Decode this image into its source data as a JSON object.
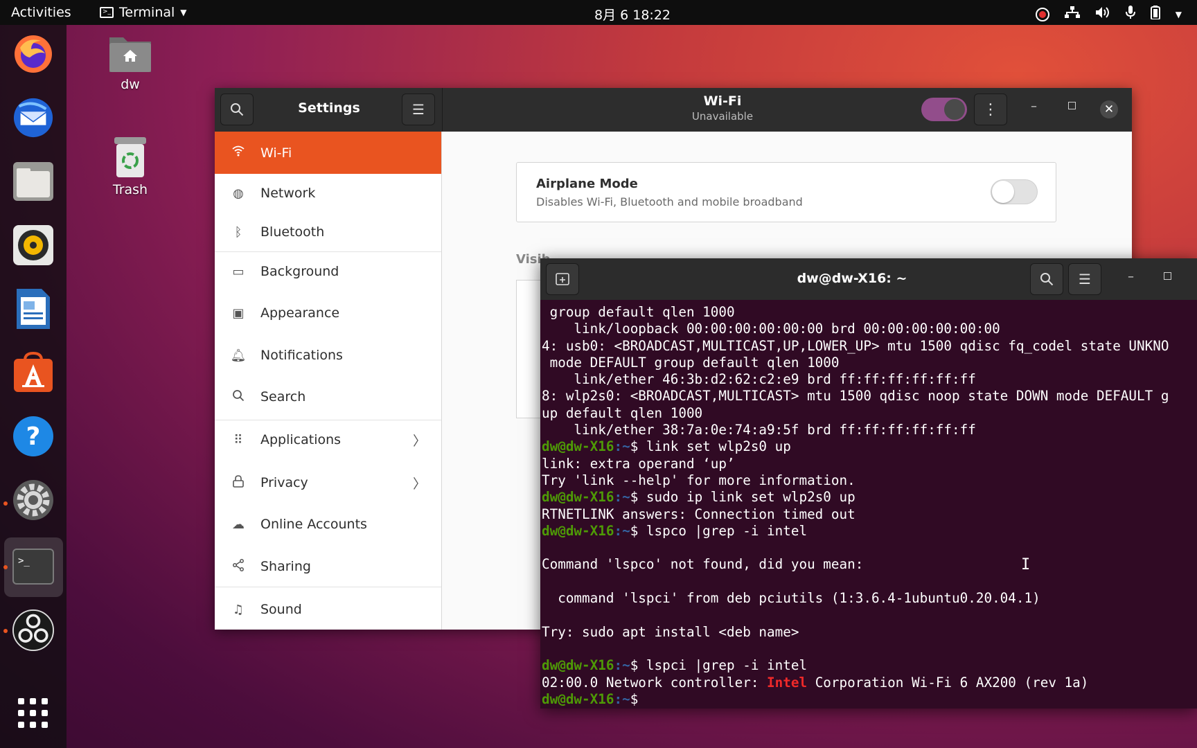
{
  "topbar": {
    "activities": "Activities",
    "app_name": "Terminal",
    "clock": "8月 6  18:22"
  },
  "desktop": {
    "home_label": "dw",
    "trash_label": "Trash"
  },
  "settings": {
    "title": "Settings",
    "panel_title": "Wi-Fi",
    "panel_subtitle": "Unavailable",
    "sidebar": [
      {
        "label": "Wi-Fi",
        "icon": "wifi-icon"
      },
      {
        "label": "Network",
        "icon": "network-icon"
      },
      {
        "label": "Bluetooth",
        "icon": "bluetooth-icon"
      },
      {
        "label": "Background",
        "icon": "background-icon"
      },
      {
        "label": "Appearance",
        "icon": "appearance-icon"
      },
      {
        "label": "Notifications",
        "icon": "bell-icon"
      },
      {
        "label": "Search",
        "icon": "search-icon"
      },
      {
        "label": "Applications",
        "icon": "grid-icon"
      },
      {
        "label": "Privacy",
        "icon": "lock-icon"
      },
      {
        "label": "Online Accounts",
        "icon": "cloud-icon"
      },
      {
        "label": "Sharing",
        "icon": "share-icon"
      },
      {
        "label": "Sound",
        "icon": "music-note-icon"
      }
    ],
    "airplane": {
      "title": "Airplane Mode",
      "desc": "Disables Wi-Fi, Bluetooth and mobile broadband"
    },
    "visible_networks_partial": "Visib"
  },
  "terminal": {
    "title": "dw@dw-X16: ~",
    "prompt_user": "dw@dw-X16",
    "prompt_path": ":~",
    "lines": [
      {
        "text": " group default qlen 1000"
      },
      {
        "text": "    link/loopback 00:00:00:00:00:00 brd 00:00:00:00:00:00"
      },
      {
        "text": "4: usb0: <BROADCAST,MULTICAST,UP,LOWER_UP> mtu 1500 qdisc fq_codel state UNKNO"
      },
      {
        "text": " mode DEFAULT group default qlen 1000"
      },
      {
        "text": "    link/ether 46:3b:d2:62:c2:e9 brd ff:ff:ff:ff:ff:ff"
      },
      {
        "text": "8: wlp2s0: <BROADCAST,MULTICAST> mtu 1500 qdisc noop state DOWN mode DEFAULT g"
      },
      {
        "text": "up default qlen 1000"
      },
      {
        "text": "    link/ether 38:7a:0e:74:a9:5f brd ff:ff:ff:ff:ff:ff"
      },
      {
        "prompt": true,
        "cmd": "$ link set wlp2s0 up"
      },
      {
        "text": "link: extra operand ‘up’"
      },
      {
        "text": "Try 'link --help' for more information."
      },
      {
        "prompt": true,
        "cmd": "$ sudo ip link set wlp2s0 up"
      },
      {
        "text": "RTNETLINK answers: Connection timed out"
      },
      {
        "prompt": true,
        "cmd": "$ lspco |grep -i intel"
      },
      {
        "text": ""
      },
      {
        "text": "Command 'lspco' not found, did you mean:"
      },
      {
        "text": ""
      },
      {
        "text": "  command 'lspci' from deb pciutils (1:3.6.4-1ubuntu0.20.04.1)"
      },
      {
        "text": ""
      },
      {
        "text": "Try: sudo apt install <deb name>"
      },
      {
        "text": ""
      },
      {
        "prompt": true,
        "cmd": "$ lspci |grep -i intel"
      },
      {
        "pre": "02:00.0 Network controller: ",
        "hl": "Intel",
        "post": " Corporation Wi-Fi 6 AX200 (rev 1a)"
      },
      {
        "prompt": true,
        "cmd": "$ "
      }
    ]
  },
  "colors": {
    "accent": "#e95420",
    "prompt_user": "#4e9a06",
    "prompt_path": "#3465a4",
    "terminal_bg": "#300a24"
  }
}
